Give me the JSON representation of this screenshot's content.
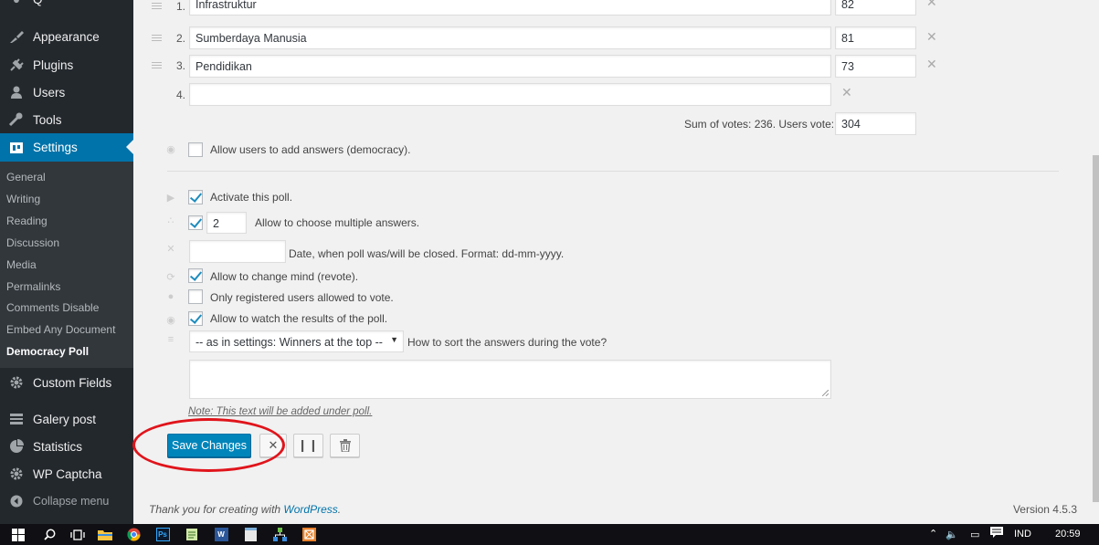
{
  "sidebar": {
    "partial_top": "Q",
    "menu": [
      {
        "label": "Appearance",
        "icon": "paintbrush-icon"
      },
      {
        "label": "Plugins",
        "icon": "plugin-icon"
      },
      {
        "label": "Users",
        "icon": "users-icon"
      },
      {
        "label": "Tools",
        "icon": "wrench-icon"
      },
      {
        "label": "Settings",
        "icon": "settings-icon"
      }
    ],
    "submenu": [
      "General",
      "Writing",
      "Reading",
      "Discussion",
      "Media",
      "Permalinks",
      "Comments Disable",
      "Embed Any Document",
      "Democracy Poll"
    ],
    "menu_after": [
      {
        "label": "Custom Fields",
        "icon": "gear-icon"
      },
      {
        "label": "Galery post",
        "icon": "gallery-icon"
      },
      {
        "label": "Statistics",
        "icon": "pie-chart-icon"
      },
      {
        "label": "WP Captcha",
        "icon": "gear-icon"
      }
    ],
    "collapse_label": "Collapse menu"
  },
  "answers": [
    {
      "num": "1.",
      "text": "Infrastruktur",
      "votes": "82"
    },
    {
      "num": "2.",
      "text": "Sumberdaya Manusia",
      "votes": "81"
    },
    {
      "num": "3.",
      "text": "Pendidikan",
      "votes": "73"
    },
    {
      "num": "4.",
      "text": "",
      "votes": ""
    }
  ],
  "sum_votes_label": "Sum of votes: 236. Users vote:",
  "users_vote_value": "304",
  "options": {
    "democracy": "Allow users to add answers (democracy).",
    "activate": "Activate this poll.",
    "multiple_value": "2",
    "multiple": "Allow to choose multiple answers.",
    "close_date_value": "",
    "close_date": "Date, when poll was/will be closed. Format: dd-mm-yyyy.",
    "revote": "Allow to change mind (revote).",
    "registered": "Only registered users allowed to vote.",
    "watch_results": "Allow to watch the results of the poll.",
    "sort_select": "-- as in settings: Winners at the top --",
    "sort_label": "How to sort the answers during the vote?",
    "note": "Note: This text will be added under poll."
  },
  "buttons": {
    "save": "Save Changes"
  },
  "footer": {
    "thanks_prefix": "Thank you for creating with ",
    "thanks_link": "WordPress",
    "thanks_suffix": ".",
    "version": "Version 4.5.3"
  },
  "taskbar": {
    "lang": "IND",
    "time": "20:59"
  },
  "colors": {
    "accent": "#0073aa",
    "primary_button": "#0085ba",
    "sidebar": "#23282d",
    "annotation": "#e0141b"
  }
}
